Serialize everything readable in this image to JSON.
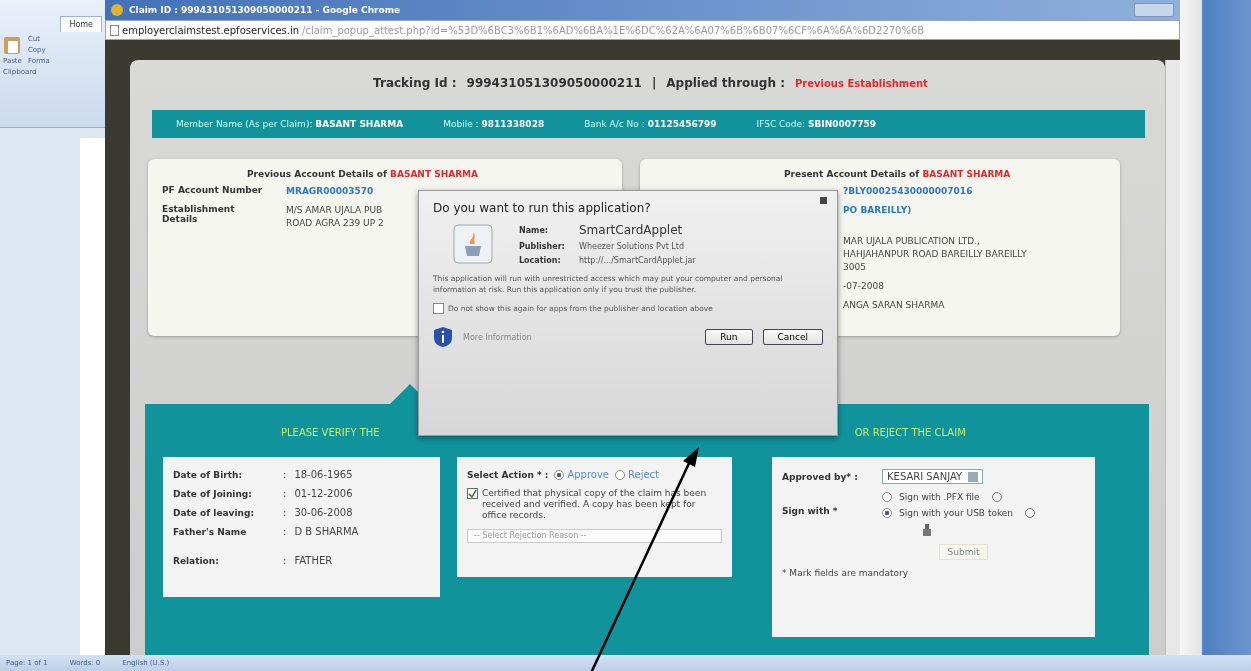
{
  "word": {
    "tab": "Home",
    "paste": "Paste",
    "clipboard_items": [
      "Cut",
      "Copy",
      "Forma"
    ],
    "group": "Clipboard"
  },
  "browser": {
    "title": "Claim ID : 999431051309050000211 - Google Chrome",
    "url_host": "employerclaimstest.epfoservices.in",
    "url_path": "/claim_popup_attest.php?id=%53D%6BC3%6B1%6AD%6BA%1E%6DC%62A%6A07%6B%6B07%6CF%6A%6A%6D2270%6B"
  },
  "header": {
    "tracking_label": "Tracking Id :",
    "tracking_value": "999431051309050000211",
    "separator": "|",
    "applied_label": "Applied through :",
    "applied_value": "Previous Establishment"
  },
  "member_bar": [
    {
      "label": "Member Name (As per Claim):",
      "value": "BASANT SHARMA"
    },
    {
      "label": "Mobile :",
      "value": "9811338028"
    },
    {
      "label": "Bank A/c No :",
      "value": "01125456799"
    },
    {
      "label": "IFSC Code:",
      "value": "SBIN0007759"
    }
  ],
  "previous_account": {
    "title": "Previous Account Details of",
    "name": "BASANT SHARMA",
    "rows": [
      {
        "label": "PF Account Number",
        "lines": [
          "MRAGR00003570"
        ],
        "kind": "link"
      },
      {
        "label": "Establishment Details",
        "lines": [
          "M/S AMAR UJALA PUB",
          "ROAD AGRA 239 UP 2"
        ],
        "kind": "text"
      }
    ]
  },
  "present_account": {
    "title": "Present Account Details of",
    "name": "BASANT SHARMA",
    "rows": [
      {
        "lines": [
          "?BLY00025430000007016"
        ],
        "kind": "link"
      },
      {
        "lines": [
          "PO BAREILLY)"
        ],
        "kind": "link"
      },
      {
        "lines": [
          "MAR UJALA PUBLICATION LTD.,",
          "HAHJAHANPUR ROAD BAREILLY BAREILLY",
          "3005"
        ],
        "kind": "text"
      },
      {
        "lines": [
          "-07-2008"
        ],
        "kind": "text"
      },
      {
        "lines": [
          "ANGA SARAN SHARMA"
        ],
        "kind": "text"
      }
    ]
  },
  "verify": {
    "heading_left": "PLEASE VERIFY THE",
    "heading_right": "OR REJECT THE CLAIM",
    "detail_separator": ":",
    "details": [
      {
        "label": "Date of Birth:",
        "value": "18-06-1965"
      },
      {
        "label": "Date of Joining:",
        "value": "01-12-2006"
      },
      {
        "label": "Date of leaving:",
        "value": "30-06-2008"
      },
      {
        "label": "Father's Name",
        "value": "D B SHARMA"
      },
      {
        "label": "Relation:",
        "value": "FATHER"
      }
    ],
    "action": {
      "label": "Select Action * :",
      "options": [
        {
          "label": "Approve",
          "selected": true
        },
        {
          "label": "Reject",
          "selected": false
        }
      ],
      "certify": {
        "checked": true,
        "text": "Certified that physical copy of the claim has been received and verified. A copy has been kept for office records."
      },
      "reason": {
        "placeholder": "-- Select Rejection Reason --",
        "disabled": true
      }
    },
    "approval": {
      "approved_by_label": "Approved by* :",
      "approver": "KESARI SANJAY",
      "sign_label": "Sign with *",
      "sign_options": [
        {
          "label": "Sign with .PFX file",
          "selected": false
        },
        {
          "label": "Sign with your USB token",
          "selected": true
        }
      ],
      "submit": "Submit",
      "note": "* Mark fields are mandatory"
    }
  },
  "dialog": {
    "title": "Do you want to run this application?",
    "fields": [
      {
        "label": "Name:",
        "value": "SmartCardApplet"
      },
      {
        "label": "Publisher:",
        "value": "Wheezer Solutions Pvt Ltd"
      },
      {
        "label": "Location:",
        "value": "http://.../SmartCardApplet.jar"
      }
    ],
    "warning": "This application will run with unrestricted access which may put your computer and personal information at risk. Run this application only if you trust the publisher.",
    "checkbox": {
      "label": "Do not show this again for apps from the publisher and location above",
      "checked": false
    },
    "more_info": "More Information",
    "buttons": [
      "Run",
      "Cancel"
    ]
  },
  "status_bar": [
    "Page: 1 of 1",
    "Words: 0",
    "English (U.S.)"
  ]
}
